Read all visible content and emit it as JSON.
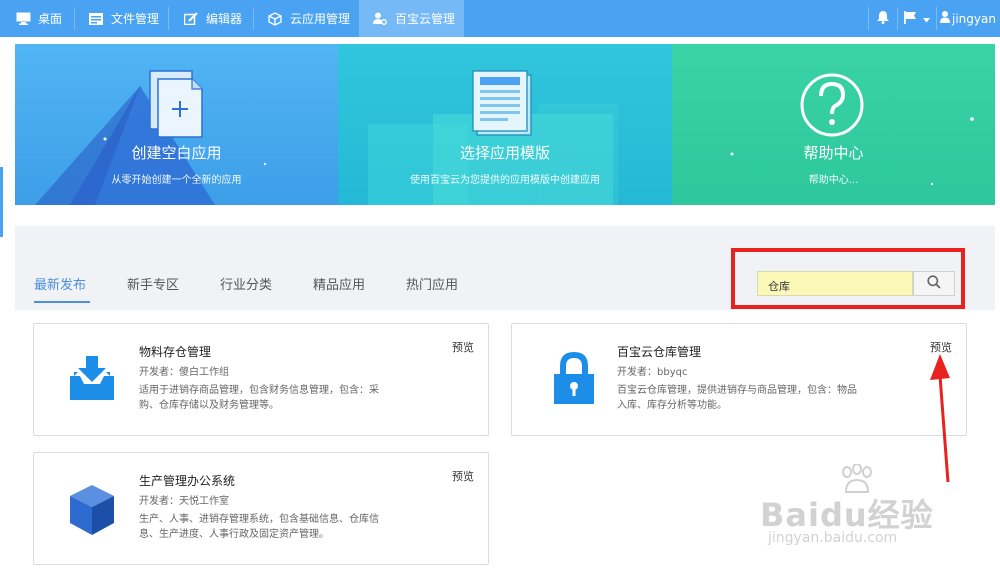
{
  "nav": {
    "items": [
      {
        "label": "桌面",
        "icon": "monitor-icon"
      },
      {
        "label": "文件管理",
        "icon": "folder-icon"
      },
      {
        "label": "编辑器",
        "icon": "edit-icon"
      },
      {
        "label": "云应用管理",
        "icon": "cube-icon"
      },
      {
        "label": "百宝云管理",
        "icon": "user-cog-icon"
      }
    ],
    "active_index": 4,
    "username": "jingyan"
  },
  "banners": [
    {
      "title": "创建空白应用",
      "subtitle": "从零开始创建一个全新的应用",
      "color": "#3d9ee8"
    },
    {
      "title": "选择应用模版",
      "subtitle": "使用百宝云为您提供的应用模版中创建应用",
      "color": "#2ec4d6"
    },
    {
      "title": "帮助中心",
      "subtitle": "帮助中心...",
      "color": "#33cfa3"
    }
  ],
  "tabs": [
    "最新发布",
    "新手专区",
    "行业分类",
    "精品应用",
    "热门应用"
  ],
  "search": {
    "value": "仓库"
  },
  "cards": [
    {
      "title": "物料存仓管理",
      "developer": "开发者：傻白工作组",
      "description": "适用于进销存商品管理，包含财务信息管理，包含：采购、仓库存储以及财务管理等。",
      "preview": "预览",
      "icon": "inbox-download-icon"
    },
    {
      "title": "百宝云仓库管理",
      "developer": "开发者：bbyqc",
      "description": "百宝云仓库管理，提供进销存与商品管理，包含：物品入库、库存分析等功能。",
      "preview": "预览",
      "icon": "lock-icon"
    },
    {
      "title": "生产管理办公系统",
      "developer": "开发者：天悦工作室",
      "description": "生产、人事、进销存管理系统，包含基础信息、仓库信息、生产进度、人事行政及固定资产管理。",
      "preview": "预览",
      "icon": "cube-icon"
    }
  ],
  "watermark": {
    "brand": "Baidu经验",
    "url": "jingyan.baidu.com"
  },
  "colors": {
    "topbar": "#4aa3f2",
    "accent": "#4a90d9",
    "highlight": "#e8231f",
    "icon_blue": "#1c8ee8"
  }
}
